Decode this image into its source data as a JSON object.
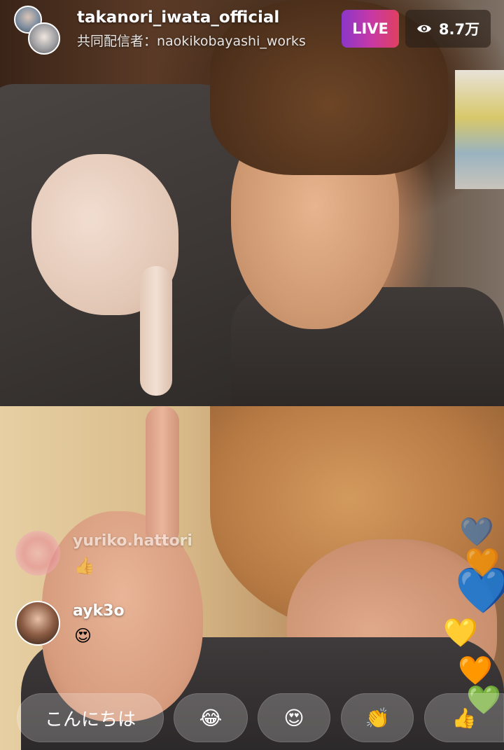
{
  "header": {
    "host_username": "takanori_iwata_official",
    "cohost_text": "共同配信者：naokikobayashi_works",
    "live_label": "LIVE",
    "viewer_count": "8.7万",
    "icons": [
      "host-avatar",
      "cohost-avatar",
      "eye-icon"
    ]
  },
  "comments": [
    {
      "username": "yuriko.hattori",
      "text": "👍",
      "faded": true
    },
    {
      "username": "ayk3o",
      "text": "😍",
      "faded": false
    }
  ],
  "floating_hearts": [
    "💙",
    "💙",
    "🧡",
    "💛",
    "🧡",
    "💚"
  ],
  "quick_reactions": [
    {
      "label": "こんにちは"
    },
    {
      "label": "😂"
    },
    {
      "label": "😍"
    },
    {
      "label": "👏"
    },
    {
      "label": "👍"
    }
  ],
  "colors": {
    "live_gradient_start": "#8a37c9",
    "live_gradient_end": "#e0405f",
    "chip_background": "rgba(255,255,255,0.22)"
  }
}
